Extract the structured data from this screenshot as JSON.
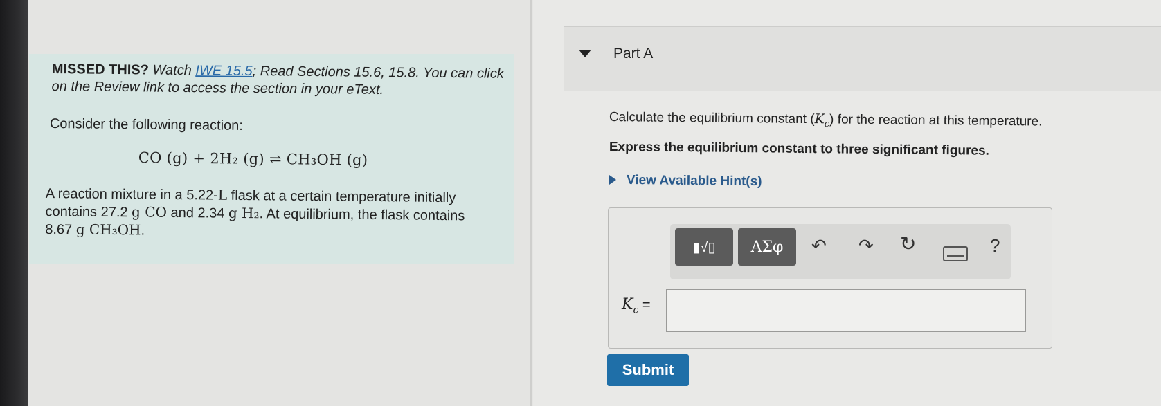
{
  "problem": {
    "missed_prefix": "MISSED THIS?",
    "missed_watch": "Watch",
    "missed_link": "IWE 15.5",
    "missed_rest": "; Read Sections 15.6, 15.8. You can click on the Review link to access the section in your eText.",
    "consider": "Consider the following reaction:",
    "equation": "CO (g) + 2H₂ (g) ⇌ CH₃OH (g)",
    "mixture_1": "A reaction mixture in a 5.22-",
    "mixture_unit_L": "L",
    "mixture_2": " flask at a certain temperature initially contains 27.2 ",
    "mixture_g1": "g CO",
    "mixture_3": " and 2.34 ",
    "mixture_g2": "g H₂",
    "mixture_4": ". At equilibrium, the flask contains 8.67 ",
    "mixture_g3": "g CH₃OH",
    "mixture_5": "."
  },
  "part": {
    "title": "Part A",
    "calc_text_1": "Calculate the equilibrium constant (",
    "calc_symbol": "Kc",
    "calc_text_2": ") for the reaction at this temperature.",
    "express": "Express the equilibrium constant to three significant figures.",
    "hint": "View Available Hint(s)"
  },
  "toolbar": {
    "templates_label": "▮√▯",
    "greek_label": "ΑΣφ",
    "undo_icon": "undo-icon",
    "redo_icon": "redo-icon",
    "reset_icon": "reset-icon",
    "keyboard_icon": "keyboard-icon",
    "help_label": "?"
  },
  "answer": {
    "label_K": "K",
    "label_sub": "c",
    "label_eq": " =",
    "value": ""
  },
  "submit_label": "Submit"
}
